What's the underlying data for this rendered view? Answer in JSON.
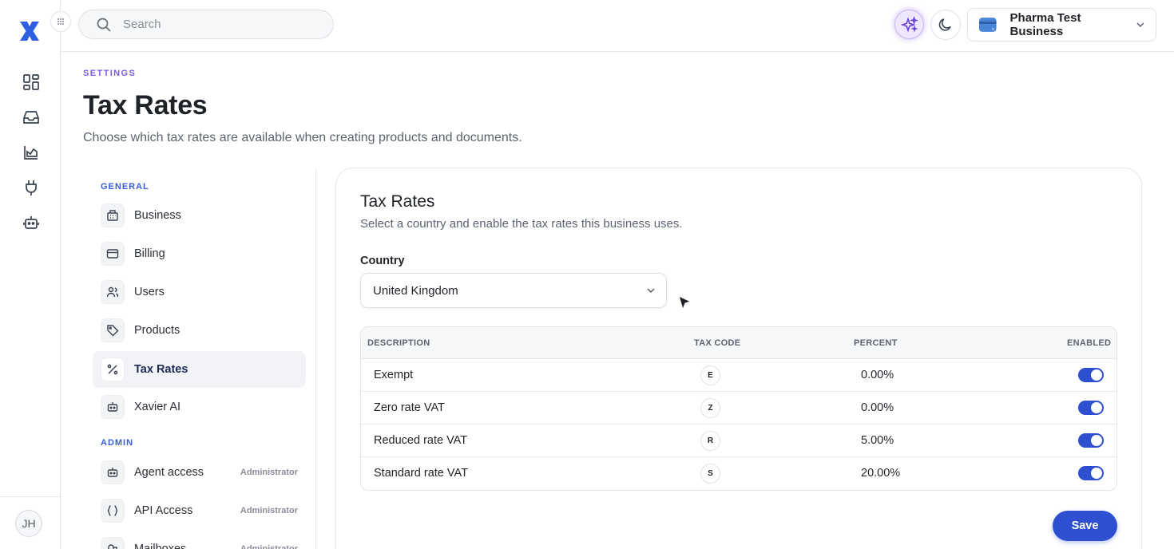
{
  "topbar": {
    "search_placeholder": "Search",
    "business_name": "Pharma Test Business"
  },
  "rail": {
    "avatar_initials": "JH",
    "icons": [
      "dashboard-icon",
      "inbox-icon",
      "analytics-icon",
      "plug-icon",
      "robot-icon"
    ]
  },
  "header": {
    "eyebrow": "SETTINGS",
    "title": "Tax Rates",
    "subtitle": "Choose which tax rates are available when creating products and documents."
  },
  "sidebar": {
    "general_label": "GENERAL",
    "admin_label": "ADMIN",
    "items": [
      {
        "label": "Business",
        "icon": "building-icon"
      },
      {
        "label": "Billing",
        "icon": "credit-card-icon"
      },
      {
        "label": "Users",
        "icon": "users-icon"
      },
      {
        "label": "Products",
        "icon": "tag-icon"
      },
      {
        "label": "Tax Rates",
        "icon": "percent-icon",
        "active": true
      },
      {
        "label": "Xavier AI",
        "icon": "robot-icon"
      }
    ],
    "admin_items": [
      {
        "label": "Agent access",
        "role": "Administrator",
        "icon": "robot-icon"
      },
      {
        "label": "API Access",
        "role": "Administrator",
        "icon": "braces-icon"
      },
      {
        "label": "Mailboxes",
        "role": "Administrator",
        "icon": "mailbox-icon"
      }
    ]
  },
  "card": {
    "title": "Tax Rates",
    "subtitle": "Select a country and enable the tax rates this business uses.",
    "country_label": "Country",
    "country_value": "United Kingdom",
    "columns": {
      "description": "DESCRIPTION",
      "tax_code": "TAX CODE",
      "percent": "PERCENT",
      "enabled": "ENABLED"
    },
    "rows": [
      {
        "description": "Exempt",
        "code": "E",
        "percent": "0.00%",
        "enabled": true
      },
      {
        "description": "Zero rate VAT",
        "code": "Z",
        "percent": "0.00%",
        "enabled": true
      },
      {
        "description": "Reduced rate VAT",
        "code": "R",
        "percent": "5.00%",
        "enabled": true
      },
      {
        "description": "Standard rate VAT",
        "code": "S",
        "percent": "20.00%",
        "enabled": true
      }
    ],
    "save_label": "Save"
  },
  "colors": {
    "accent": "#2d4fd0",
    "eyebrow": "#7c5ce0",
    "group_label": "#3b5bd6"
  }
}
